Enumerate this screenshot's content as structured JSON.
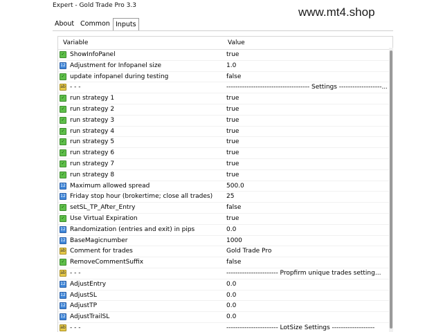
{
  "window": {
    "title": "Expert - Gold Trade Pro 3.3",
    "watermark": "www.mt4.shop"
  },
  "tabs": [
    {
      "label": "About"
    },
    {
      "label": "Common"
    },
    {
      "label": "Inputs"
    }
  ],
  "active_tab": "Inputs",
  "table": {
    "columns": [
      "Variable",
      "Value"
    ],
    "rows": [
      {
        "icon": "bool",
        "variable": "ShowInfoPanel",
        "value": "true"
      },
      {
        "icon": "num",
        "variable": "Adjustment for Infopanel size",
        "value": "1.0"
      },
      {
        "icon": "bool",
        "variable": "update infopanel during testing",
        "value": "false"
      },
      {
        "icon": "str",
        "variable": "- - -",
        "value": "------------------------------------- Settings -------------------..."
      },
      {
        "icon": "bool",
        "variable": "run strategy 1",
        "value": "true"
      },
      {
        "icon": "bool",
        "variable": "run strategy 2",
        "value": "true"
      },
      {
        "icon": "bool",
        "variable": "run strategy 3",
        "value": "true"
      },
      {
        "icon": "bool",
        "variable": "run strategy 4",
        "value": "true"
      },
      {
        "icon": "bool",
        "variable": "run strategy 5",
        "value": "true"
      },
      {
        "icon": "bool",
        "variable": "run strategy 6",
        "value": "true"
      },
      {
        "icon": "bool",
        "variable": "run strategy 7",
        "value": "true"
      },
      {
        "icon": "bool",
        "variable": "run strategy 8",
        "value": "true"
      },
      {
        "icon": "num",
        "variable": "Maximum allowed spread",
        "value": "500.0"
      },
      {
        "icon": "num",
        "variable": "Friday stop hour (brokertime; close all trades)",
        "value": "25"
      },
      {
        "icon": "bool",
        "variable": "setSL_TP_After_Entry",
        "value": "false"
      },
      {
        "icon": "bool",
        "variable": "Use Virtual Expiration",
        "value": "true"
      },
      {
        "icon": "num",
        "variable": "Randomization (entries and exit) in pips",
        "value": "0.0"
      },
      {
        "icon": "num",
        "variable": "BaseMagicnumber",
        "value": "1000"
      },
      {
        "icon": "str",
        "variable": "Comment for trades",
        "value": "Gold Trade Pro"
      },
      {
        "icon": "bool",
        "variable": "RemoveCommentSuffix",
        "value": "false"
      },
      {
        "icon": "str",
        "variable": "- - -",
        "value": "----------------------- Propfirm unique trades setting..."
      },
      {
        "icon": "num",
        "variable": "AdjustEntry",
        "value": "0.0"
      },
      {
        "icon": "num",
        "variable": "AdjustSL",
        "value": "0.0"
      },
      {
        "icon": "num",
        "variable": "AdjustTP",
        "value": "0.0"
      },
      {
        "icon": "num",
        "variable": "AdjustTrailSL",
        "value": "0.0"
      },
      {
        "icon": "str",
        "variable": "- - -",
        "value": "----------------------- LotSize Settings -------------------"
      }
    ]
  }
}
